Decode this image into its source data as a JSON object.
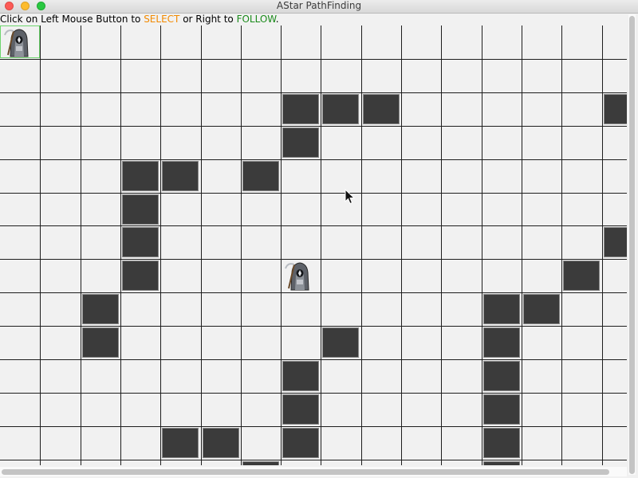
{
  "window": {
    "title": "AStar PathFinding"
  },
  "instruction": {
    "prefix": "Click on Left Mouse Button to ",
    "select_word": "SELECT",
    "middle": " or Right to ",
    "follow_word": "FOLLOW",
    "suffix": ".",
    "select_color": "#f28a00",
    "follow_color": "#1a8a1a"
  },
  "grid": {
    "columns": 16,
    "rows": 14,
    "walls": [
      [
        7,
        2
      ],
      [
        8,
        2
      ],
      [
        9,
        2
      ],
      [
        15,
        2
      ],
      [
        7,
        3
      ],
      [
        3,
        4
      ],
      [
        4,
        4
      ],
      [
        6,
        4
      ],
      [
        3,
        5
      ],
      [
        3,
        6
      ],
      [
        15,
        6
      ],
      [
        3,
        7
      ],
      [
        14,
        7
      ],
      [
        2,
        8
      ],
      [
        12,
        8
      ],
      [
        13,
        8
      ],
      [
        2,
        9
      ],
      [
        8,
        9
      ],
      [
        12,
        9
      ],
      [
        7,
        10
      ],
      [
        12,
        10
      ],
      [
        7,
        11
      ],
      [
        12,
        11
      ],
      [
        4,
        12
      ],
      [
        5,
        12
      ],
      [
        7,
        12
      ],
      [
        12,
        12
      ],
      [
        6,
        13
      ],
      [
        12,
        13
      ]
    ],
    "wall_color": "#3b3b3b",
    "empty_color": "#f1f1f1"
  },
  "units": [
    {
      "name": "reaper-unit-selected",
      "col": 0,
      "row": 0,
      "selected": true,
      "icon": "grim-reaper-icon"
    },
    {
      "name": "reaper-unit-target",
      "col": 7,
      "row": 7,
      "selected": false,
      "icon": "grim-reaper-icon"
    }
  ],
  "selection_color": "#6fd66f"
}
